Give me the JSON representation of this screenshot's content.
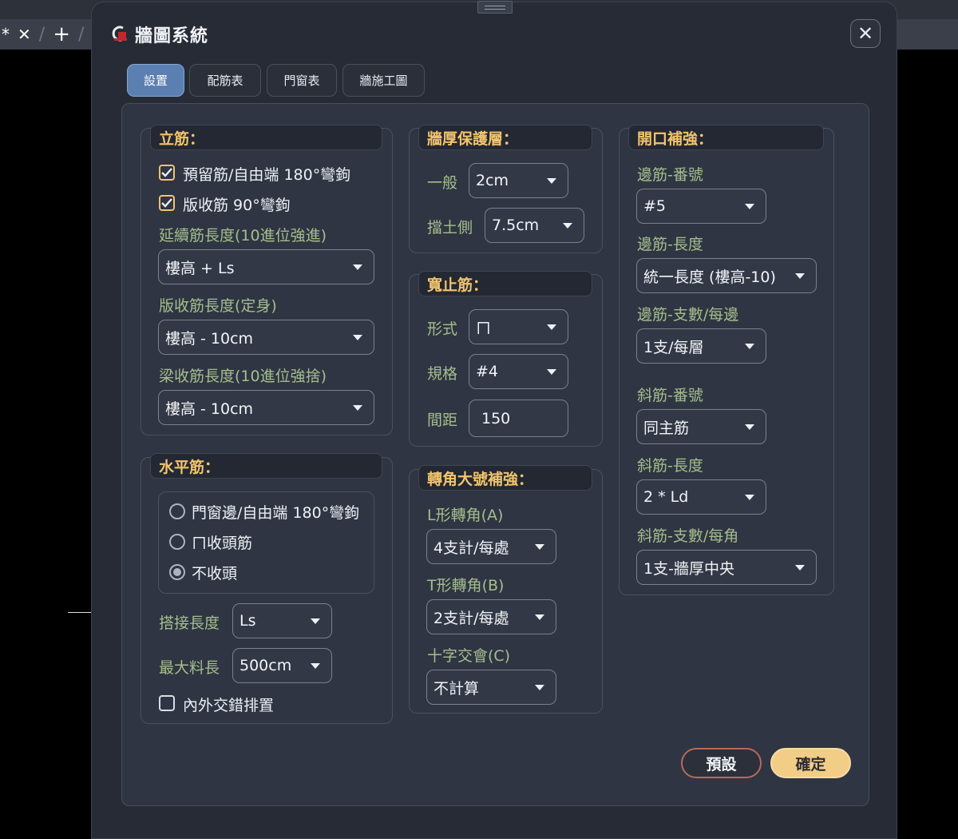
{
  "background": {
    "tab_marker": "*"
  },
  "dialog": {
    "title": "牆圖系統",
    "tabs": [
      "設置",
      "配筋表",
      "門窗表",
      "牆施工圖"
    ],
    "active_tab": "設置"
  },
  "vertical_bars": {
    "header": "立筋：",
    "check_reserve_hook": {
      "label": "預留筋/自由端 180°彎鉤",
      "checked": true
    },
    "check_slab_hook": {
      "label": "版收筋 90°彎鉤",
      "checked": true
    },
    "ext_length_label": "延續筋長度(10進位強進)",
    "ext_length_value": "樓高 + Ls",
    "slab_length_label": "版收筋長度(定身)",
    "slab_length_value": "樓高 - 10cm",
    "beam_length_label": "梁收筋長度(10進位強捨)",
    "beam_length_value": "樓高 - 10cm"
  },
  "horizontal_bars": {
    "header": "水平筋：",
    "radio_options": [
      "門窗邊/自由端 180°彎鉤",
      "ㄇ收頭筋",
      "不收頭"
    ],
    "selected": "不收頭",
    "lap_label": "搭接長度",
    "lap_value": "Ls",
    "maxlen_label": "最大料長",
    "maxlen_value": "500cm",
    "stagger_label": "內外交錯排置",
    "stagger_checked": false
  },
  "cover": {
    "header": "牆厚保護層：",
    "general_label": "一般",
    "general_value": "2cm",
    "retaining_label": "擋土側",
    "retaining_value": "7.5cm"
  },
  "tie_bars": {
    "header": "寬止筋：",
    "form_label": "形式",
    "form_value": "ㄇ",
    "size_label": "規格",
    "size_value": "#4",
    "spacing_label": "間距",
    "spacing_value": "150"
  },
  "corner": {
    "header": "轉角大號補強：",
    "l_label": "L形轉角(A)",
    "l_value": "4支計/每處",
    "t_label": "T形轉角(B)",
    "t_value": "2支計/每處",
    "cross_label": "十字交會(C)",
    "cross_value": "不計算"
  },
  "opening": {
    "header": "開口補強：",
    "edge_no_label": "邊筋-番號",
    "edge_no_value": "#5",
    "edge_len_label": "邊筋-長度",
    "edge_len_value": "統一長度 (樓高-10)",
    "edge_cnt_label": "邊筋-支數/每邊",
    "edge_cnt_value": "1支/每層",
    "diag_no_label": "斜筋-番號",
    "diag_no_value": "同主筋",
    "diag_len_label": "斜筋-長度",
    "diag_len_value": "2 * Ld",
    "diag_cnt_label": "斜筋-支數/每角",
    "diag_cnt_value": "1支-牆厚中央"
  },
  "footer": {
    "default_label": "預設",
    "ok_label": "確定"
  },
  "colors": {
    "accent": "#5b7fb0",
    "header_text": "#f2c46c",
    "label_text": "#a4be8e",
    "ok_button": "#f2cd86"
  }
}
